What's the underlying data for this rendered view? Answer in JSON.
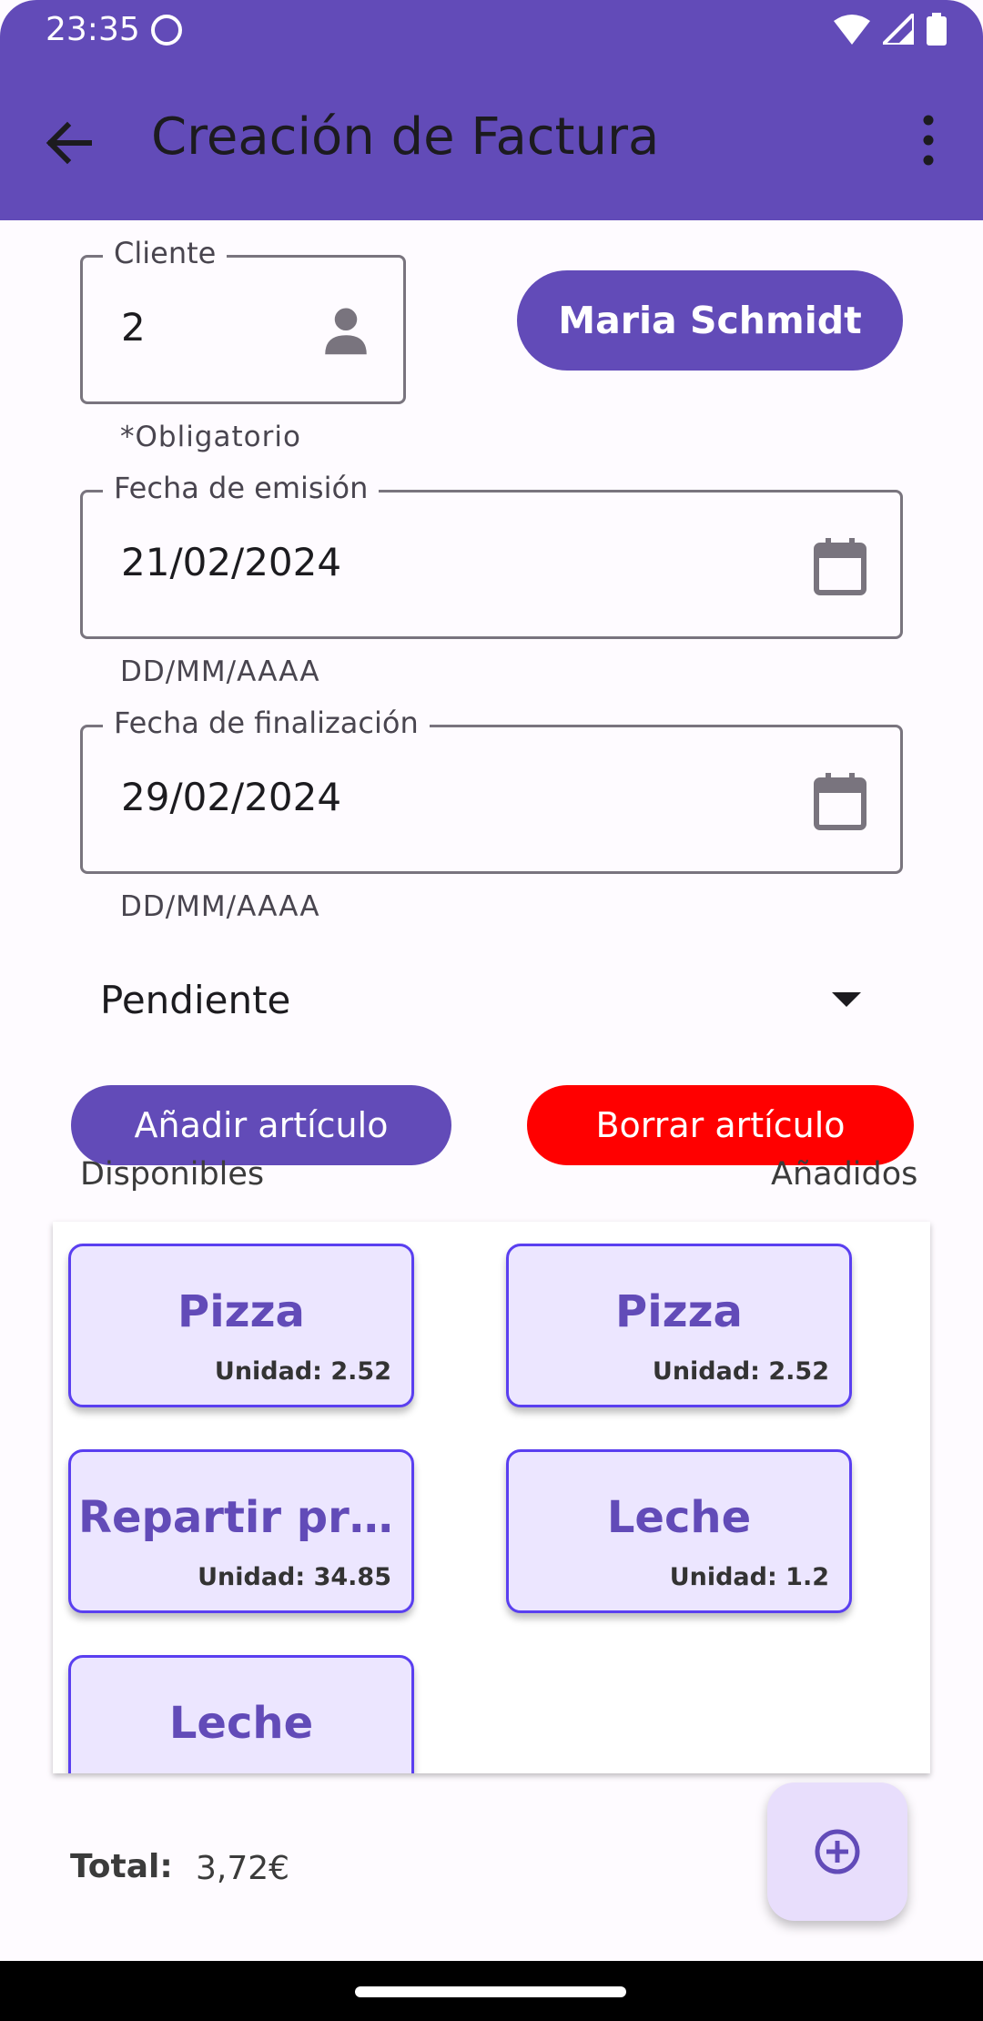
{
  "status_bar": {
    "time": "23:35"
  },
  "app_bar": {
    "title": "Creación de Factura"
  },
  "client": {
    "label": "Cliente",
    "value": "2",
    "helper": "*Obligatorio",
    "name_button": "Maria Schmidt"
  },
  "issue_date": {
    "label": "Fecha de emisión",
    "value": "21/02/2024",
    "helper": "DD/MM/AAAA"
  },
  "end_date": {
    "label": "Fecha de finalización",
    "value": "29/02/2024",
    "helper": "DD/MM/AAAA"
  },
  "status": {
    "selected": "Pendiente"
  },
  "actions": {
    "add_label": "Añadir artículo",
    "delete_label": "Borrar artículo"
  },
  "columns": {
    "available": "Disponibles",
    "added": "Añadidos"
  },
  "available_items": [
    {
      "name": "Pizza",
      "price": "Unidad: 2.52"
    },
    {
      "name": "Repartir produ…",
      "price": "Unidad: 34.85"
    },
    {
      "name": "Leche",
      "price": ""
    }
  ],
  "added_items": [
    {
      "name": "Pizza",
      "price": "Unidad: 2.52"
    },
    {
      "name": "Leche",
      "price": "Unidad: 1.2"
    }
  ],
  "total": {
    "label": "Total:",
    "value": "3,72€"
  },
  "colors": {
    "primary": "#624bb8",
    "danger": "#ff0000",
    "card_bg": "#ece6ff",
    "card_border": "#5a3ff0"
  }
}
